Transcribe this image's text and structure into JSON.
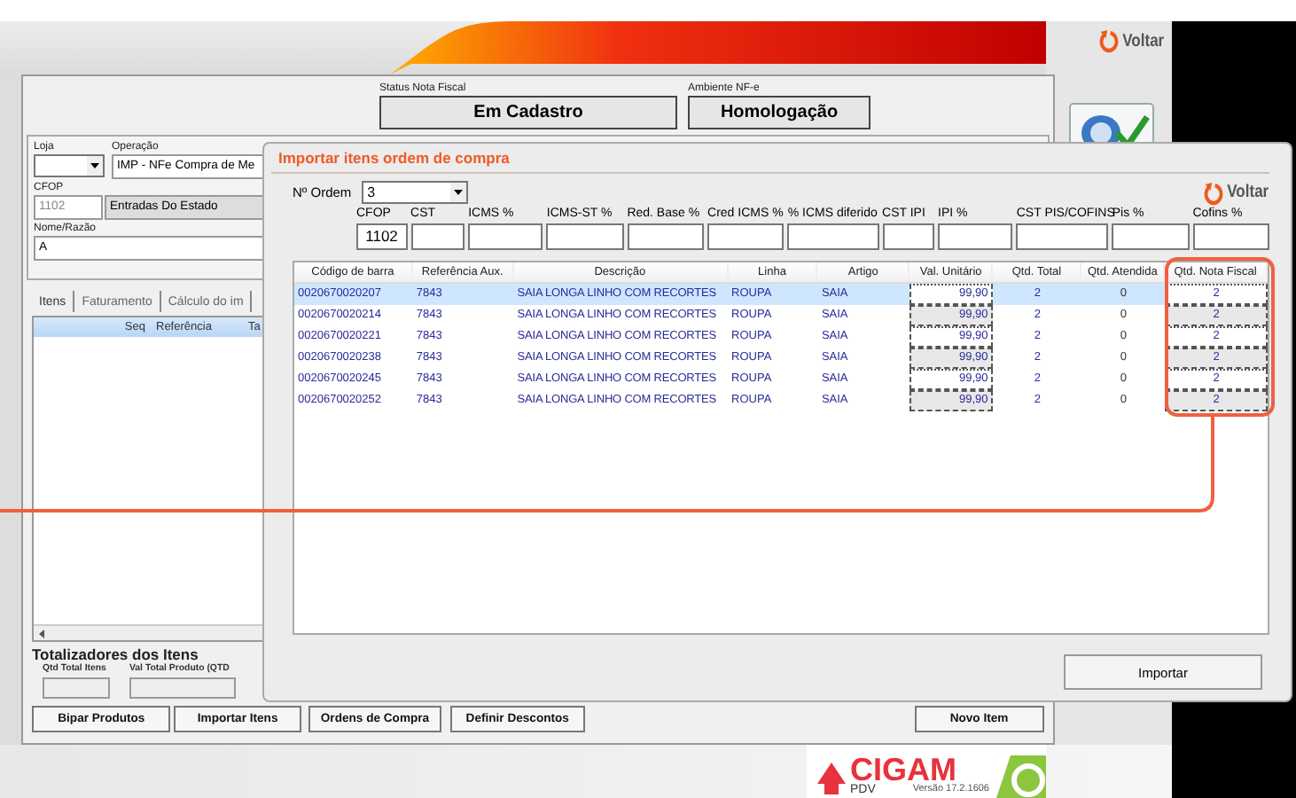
{
  "header": {
    "back_button": "Voltar"
  },
  "status": [
    {
      "label": "Status Nota Fiscal",
      "value": "Em Cadastro"
    },
    {
      "label": "Ambiente NF-e",
      "value": "Homologação"
    }
  ],
  "form": {
    "loja": {
      "label": "Loja"
    },
    "operacao": {
      "label": "Operação",
      "value": "IMP - NFe Compra de Me"
    },
    "cfop": {
      "label": "CFOP",
      "code": "1102",
      "description": "Entradas Do Estado"
    },
    "nome": {
      "label": "Nome/Razão",
      "value": "A"
    }
  },
  "tabs": [
    {
      "label": "Itens",
      "selected": true
    },
    {
      "label": "Faturamento",
      "selected": false
    },
    {
      "label": "Cálculo do im",
      "selected": false
    }
  ],
  "items_grid": {
    "columns": [
      "Seq",
      "Referência",
      "Ta"
    ]
  },
  "totals": {
    "title": "Totalizadores dos Itens",
    "fields": [
      {
        "label": "Qtd Total Itens"
      },
      {
        "label": "Val Total Produto (QTD"
      }
    ]
  },
  "buttons": [
    "Bipar Produtos",
    "Importar Itens",
    "Ordens de Compra",
    "Definir Descontos",
    "Novo Item"
  ],
  "footer": {
    "brand": "CIGAM",
    "product": "PDV",
    "version": "Versão 17.2.1606"
  },
  "dialog": {
    "title": "Importar itens ordem de compra",
    "order": {
      "label": "Nº Ordem",
      "value": "3"
    },
    "back_button": "Voltar",
    "tax_fields": [
      {
        "label": "CFOP",
        "value": "1102"
      },
      {
        "label": "CST"
      },
      {
        "label": "ICMS %"
      },
      {
        "label": "ICMS-ST %"
      },
      {
        "label": "Red. Base %"
      },
      {
        "label": "Cred ICMS %"
      },
      {
        "label": "% ICMS diferido"
      },
      {
        "label": "CST IPI"
      },
      {
        "label": "IPI %"
      },
      {
        "label": "CST PIS/COFINS"
      },
      {
        "label": "Pis %"
      },
      {
        "label": "Cofins %"
      }
    ],
    "table": {
      "columns": [
        "Código de barra",
        "Referência Aux.",
        "Descrição",
        "Linha",
        "Artigo",
        "Val. Unitário",
        "Qtd. Total",
        "Qtd. Atendida",
        "Qtd. Nota Fiscal"
      ],
      "rows": [
        {
          "selected": true,
          "cells": [
            "0020670020207",
            "7843",
            "SAIA LONGA LINHO COM RECORTES",
            "ROUPA",
            "SAIA",
            "99,90",
            "2",
            "0",
            "2"
          ]
        },
        {
          "selected": false,
          "cells": [
            "0020670020214",
            "7843",
            "SAIA LONGA LINHO COM RECORTES",
            "ROUPA",
            "SAIA",
            "99,90",
            "2",
            "0",
            "2"
          ]
        },
        {
          "selected": false,
          "cells": [
            "0020670020221",
            "7843",
            "SAIA LONGA LINHO COM RECORTES",
            "ROUPA",
            "SAIA",
            "99,90",
            "2",
            "0",
            "2"
          ]
        },
        {
          "selected": false,
          "cells": [
            "0020670020238",
            "7843",
            "SAIA LONGA LINHO COM RECORTES",
            "ROUPA",
            "SAIA",
            "99,90",
            "2",
            "0",
            "2"
          ]
        },
        {
          "selected": false,
          "cells": [
            "0020670020245",
            "7843",
            "SAIA LONGA LINHO COM RECORTES",
            "ROUPA",
            "SAIA",
            "99,90",
            "2",
            "0",
            "2"
          ]
        },
        {
          "selected": false,
          "cells": [
            "0020670020252",
            "7843",
            "SAIA LONGA LINHO COM RECORTES",
            "ROUPA",
            "SAIA",
            "99,90",
            "2",
            "0",
            "2"
          ]
        }
      ]
    },
    "import_button": "Importar"
  }
}
